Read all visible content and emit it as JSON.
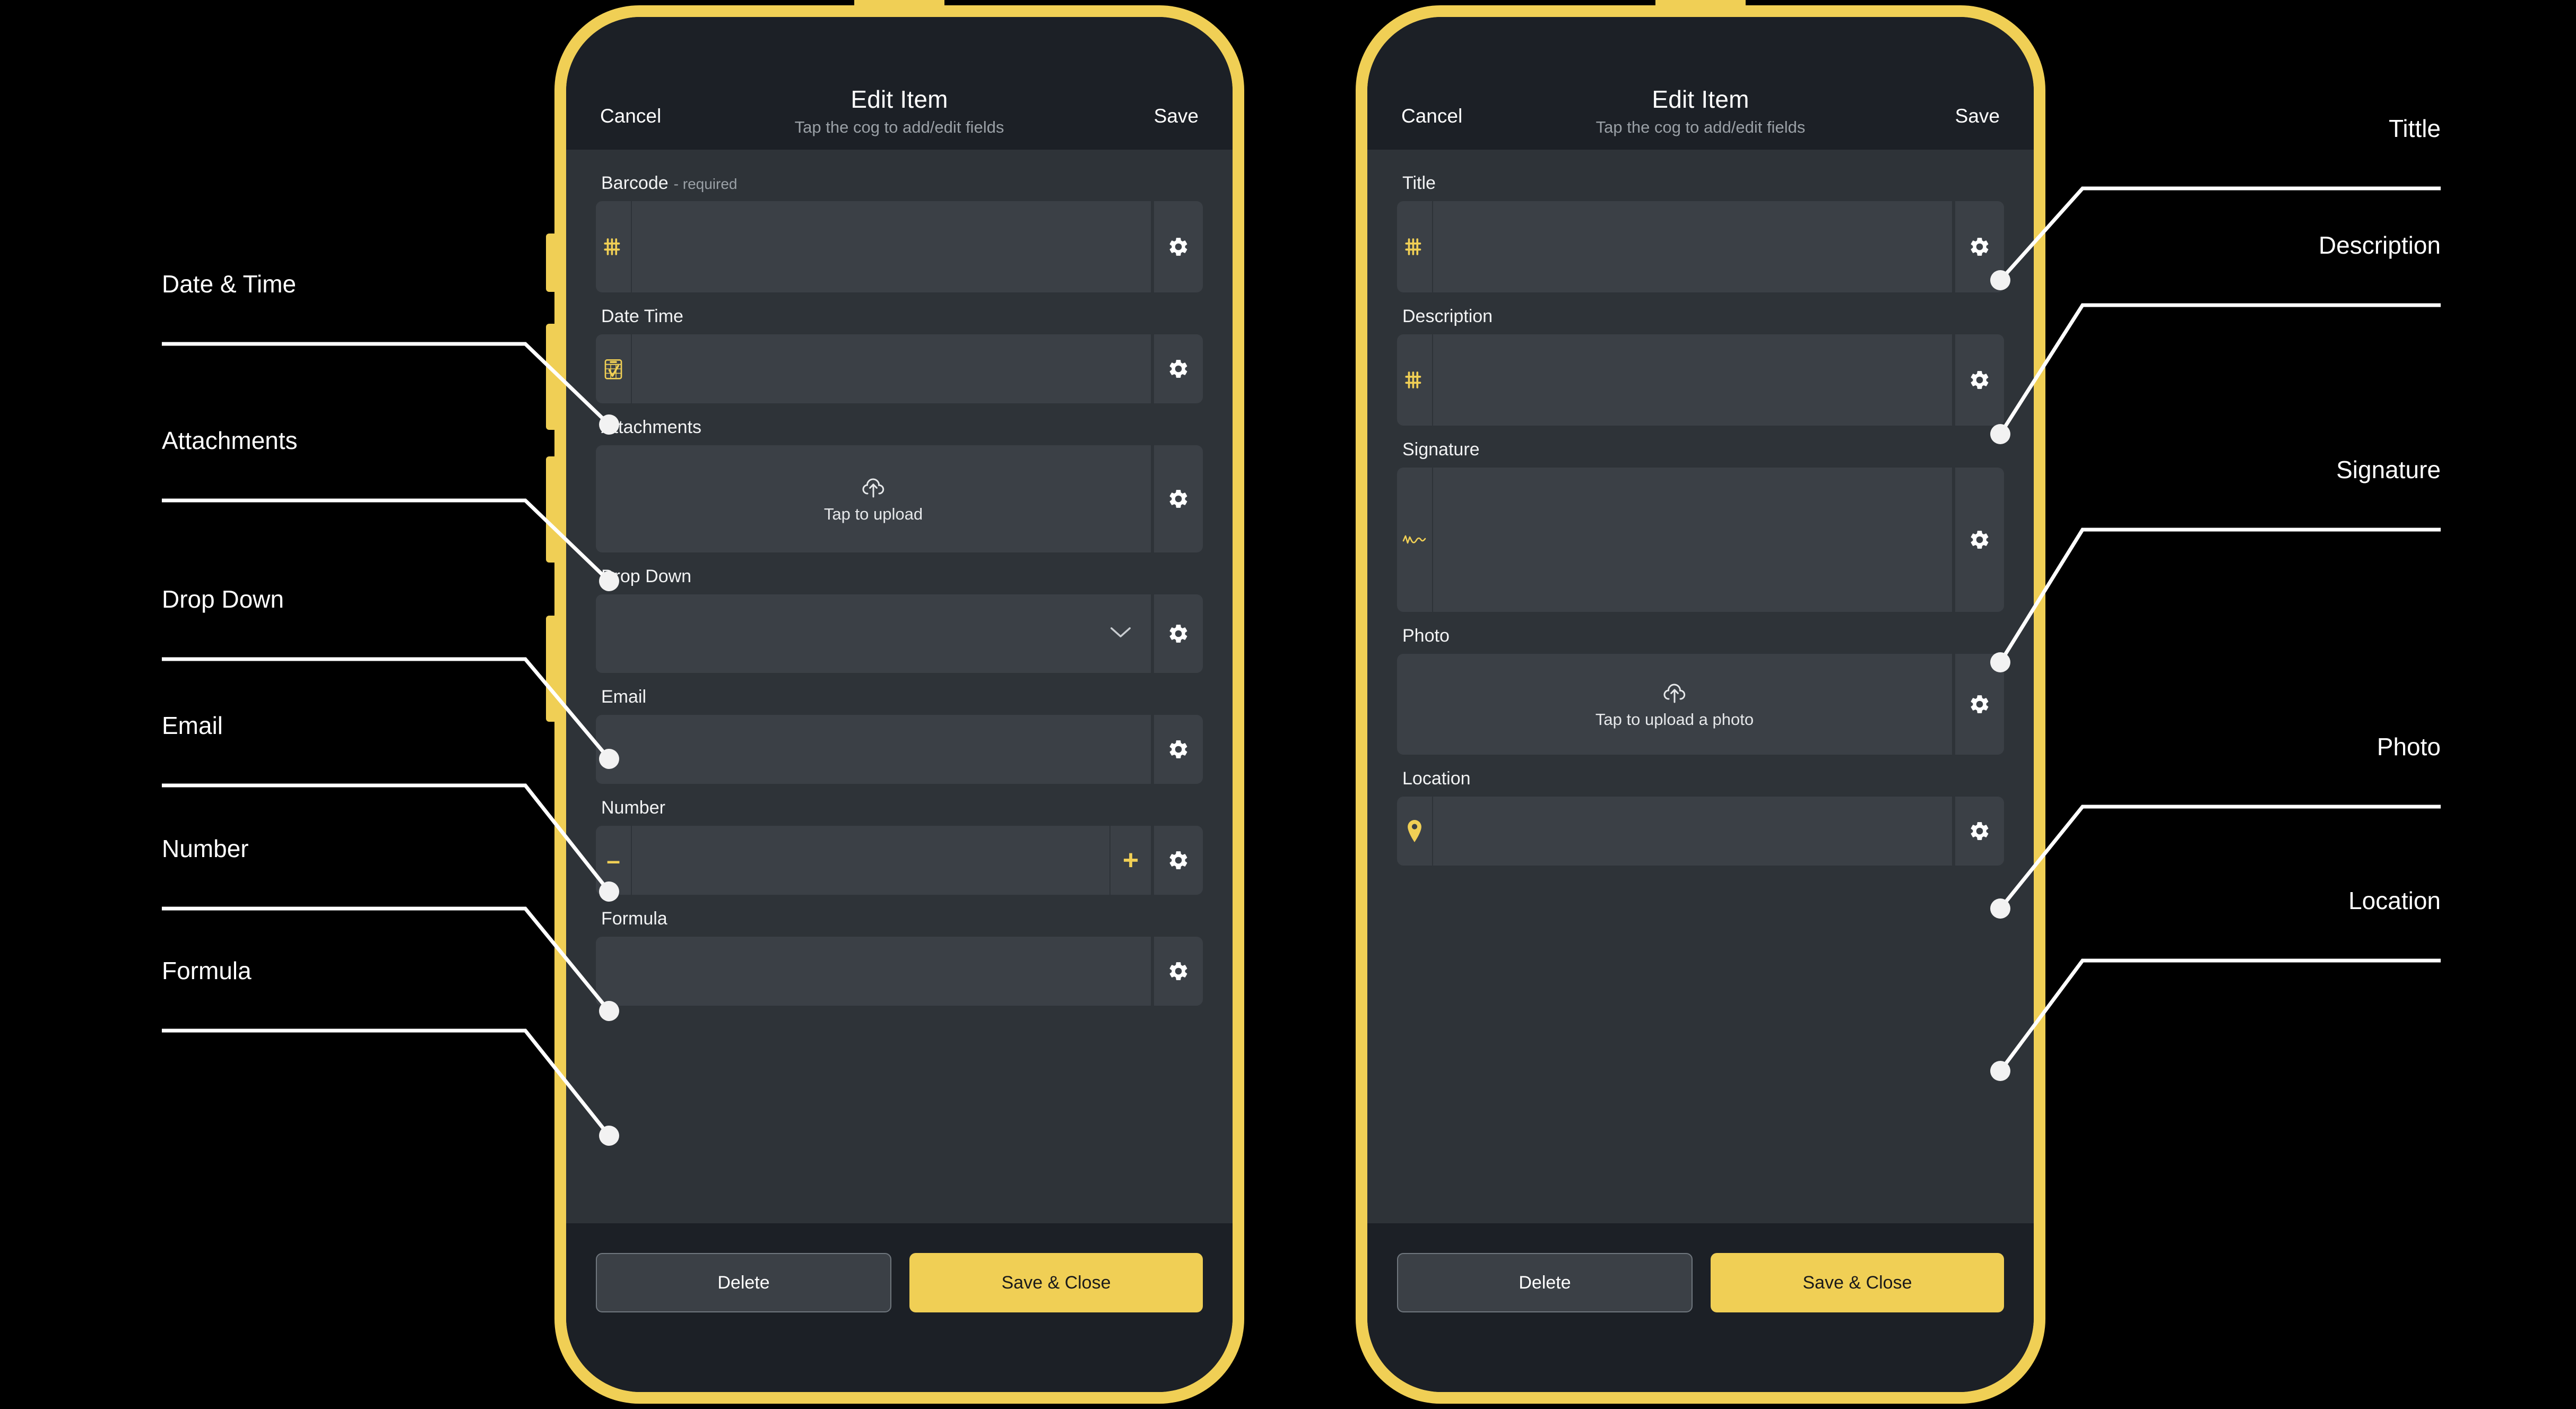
{
  "phones": [
    {
      "id": "left-phone",
      "header": {
        "cancel": "Cancel",
        "title": "Edit Item",
        "subtitle": "Tap the cog to add/edit fields",
        "save": "Save"
      },
      "fields": [
        {
          "label": "Barcode",
          "required_note": "- required",
          "icon": "barcode-icon",
          "kind": "icon-input",
          "size": "xl"
        },
        {
          "label": "Date Time",
          "required_note": "",
          "icon": "calendar-check-icon",
          "kind": "icon-input",
          "size": "md"
        },
        {
          "label": "Attachments",
          "required_note": "",
          "icon": "",
          "kind": "upload",
          "upload_label": "Tap to upload",
          "size": "xl"
        },
        {
          "label": "Drop Down",
          "required_note": "",
          "icon": "",
          "kind": "dropdown",
          "size": "lg"
        },
        {
          "label": "Email",
          "required_note": "",
          "icon": "",
          "kind": "plain",
          "size": "md"
        },
        {
          "label": "Number",
          "required_note": "",
          "icon": "minus-icon",
          "kind": "stepper",
          "minus": "–",
          "plus": "+",
          "size": "md"
        },
        {
          "label": "Formula",
          "required_note": "",
          "icon": "",
          "kind": "plain",
          "size": "md"
        }
      ],
      "footer": {
        "delete": "Delete",
        "save_close": "Save & Close"
      }
    },
    {
      "id": "right-phone",
      "header": {
        "cancel": "Cancel",
        "title": "Edit Item",
        "subtitle": "Tap the cog to add/edit fields",
        "save": "Save"
      },
      "fields": [
        {
          "label": "Title",
          "required_note": "",
          "icon": "barcode-icon",
          "kind": "icon-input",
          "size": "xl"
        },
        {
          "label": "Description",
          "required_note": "",
          "icon": "barcode-icon",
          "kind": "icon-input",
          "size": "xl"
        },
        {
          "label": "Signature",
          "required_note": "",
          "icon": "signature-icon",
          "kind": "icon-input",
          "size": "signature"
        },
        {
          "label": "Photo",
          "required_note": "",
          "icon": "",
          "kind": "upload",
          "upload_label": "Tap to upload a photo",
          "size": "photo"
        },
        {
          "label": "Location",
          "required_note": "",
          "icon": "map-pin-icon",
          "kind": "icon-input",
          "size": "md"
        }
      ],
      "footer": {
        "delete": "Delete",
        "save_close": "Save & Close"
      }
    }
  ],
  "annotations_left": [
    {
      "text": "Date & Time"
    },
    {
      "text": "Attachments"
    },
    {
      "text": "Drop Down"
    },
    {
      "text": "Email"
    },
    {
      "text": "Number"
    },
    {
      "text": "Formula"
    }
  ],
  "annotations_right": [
    {
      "text": "Tittle"
    },
    {
      "text": "Description"
    },
    {
      "text": "Signature"
    },
    {
      "text": "Photo"
    },
    {
      "text": "Location"
    }
  ],
  "colors": {
    "frame": "#f0cf55",
    "accent": "#f0cf55",
    "header_bg": "#1c2026",
    "content_bg": "#2e3338",
    "row_bg": "#3b4046",
    "background": "#000000",
    "text": "#ffffff",
    "muted_text": "#9aa0a6"
  }
}
